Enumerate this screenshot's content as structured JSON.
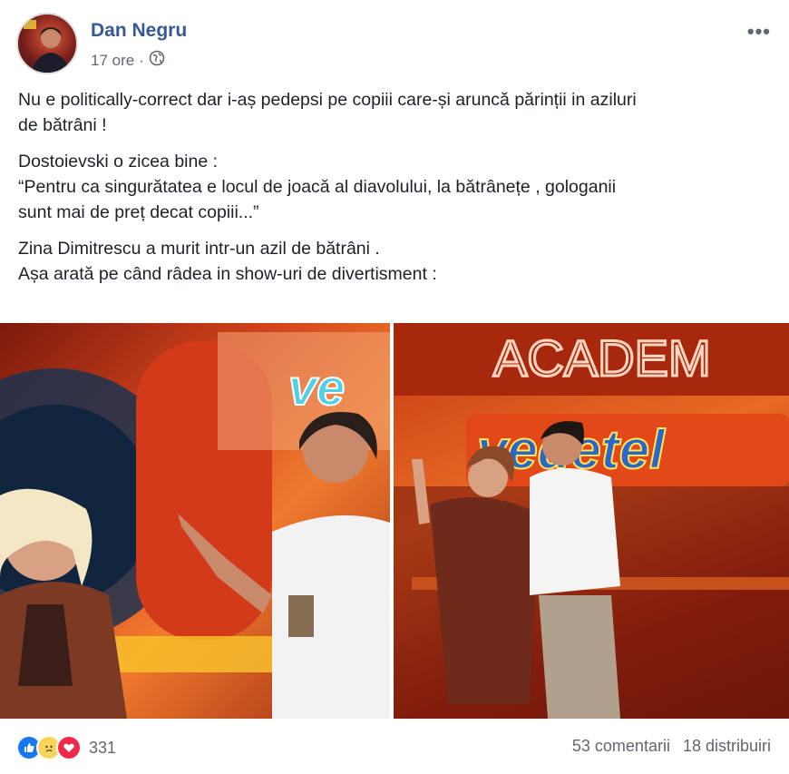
{
  "post": {
    "author": "Dan Negru",
    "time": "17 ore",
    "separator": "·",
    "visibility_icon": "globe-icon",
    "more_label": "•••",
    "paragraphs": [
      [
        "Nu e politically-correct dar i-aș pedepsi pe copiii care-și aruncă părinții in aziluri",
        "de bătrâni !"
      ],
      [
        "Dostoievski o zicea bine :",
        "“Pentru ca singurătatea e locul de joacă al diavolului, la bătrânețe , gologanii",
        "sunt mai de preț decat copiii...”"
      ],
      [
        "Zina Dimitrescu a murit intr-un azil de bătrâni .",
        "Așa arată pe când râdea in show-uri de divertisment :"
      ]
    ],
    "photo_signs": {
      "left": "ve",
      "right_top": "ACADEM",
      "right_mid": "vedetel"
    },
    "reactions": {
      "icons": [
        "like-icon",
        "sad-icon",
        "love-icon"
      ],
      "count": "331"
    },
    "comments": "53 comentarii",
    "shares": "18 distribuiri"
  },
  "colors": {
    "author": "#365899",
    "meta": "#616770",
    "text": "#1d2129",
    "like": "#1877f2",
    "love": "#f0284a",
    "sad": "#f7d55b"
  }
}
